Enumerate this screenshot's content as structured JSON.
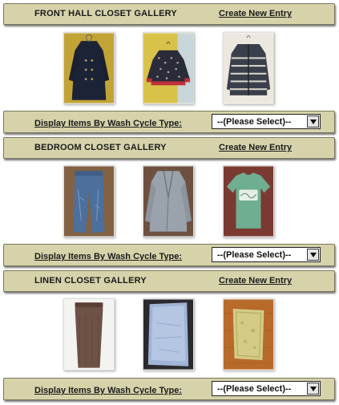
{
  "galleries": [
    {
      "title": "FRONT HALL CLOSET GALLERY",
      "create_label": "Create New Entry",
      "items": [
        {
          "name": "navy-coat-photo"
        },
        {
          "name": "patterned-jacket-photo"
        },
        {
          "name": "striped-hoodie-photo"
        }
      ]
    },
    {
      "title": "BEDROOM CLOSET GALLERY",
      "create_label": "Create New Entry",
      "items": [
        {
          "name": "jeans-photo"
        },
        {
          "name": "cardigan-photo"
        },
        {
          "name": "green-tshirt-photo"
        }
      ]
    },
    {
      "title": "LINEN CLOSET GALLERY",
      "create_label": "Create New Entry",
      "items": [
        {
          "name": "brown-towel-photo"
        },
        {
          "name": "blue-pillowcase-photo"
        },
        {
          "name": "yellow-cloth-photo"
        }
      ]
    }
  ],
  "wash_filter": {
    "label": "Display Items By Wash Cycle Type:",
    "selected": "--(Please Select)--"
  },
  "colors": {
    "bar_background": "#d6d3ab",
    "bar_border": "#7a775e",
    "text": "#1a1a1a"
  },
  "icons": {
    "select_arrow": "chevron-down-icon"
  }
}
